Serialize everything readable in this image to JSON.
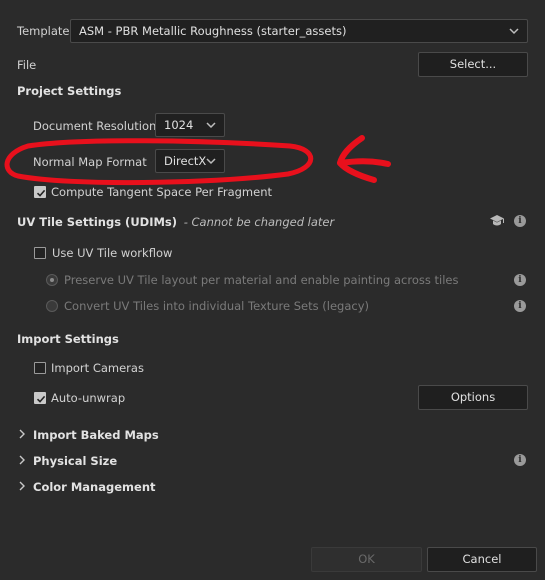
{
  "template": {
    "label": "Template",
    "value": "ASM - PBR Metallic Roughness (starter_assets)"
  },
  "file": {
    "label": "File",
    "button": "Select..."
  },
  "project_settings": {
    "heading": "Project Settings",
    "document_resolution": {
      "label": "Document Resolution",
      "value": "1024"
    },
    "normal_map_format": {
      "label": "Normal Map Format",
      "value": "DirectX"
    },
    "tangent": {
      "label": "Compute Tangent Space Per Fragment",
      "checked": true
    }
  },
  "uv_tile": {
    "heading": "UV Tile Settings (UDIMs)",
    "note": "- Cannot be changed later",
    "use_workflow": {
      "label": "Use UV Tile workflow",
      "checked": false
    },
    "option_preserve": "Preserve UV Tile layout per material and enable painting across tiles",
    "option_convert": "Convert UV Tiles into individual Texture Sets (legacy)"
  },
  "import_settings": {
    "heading": "Import Settings",
    "import_cameras": {
      "label": "Import Cameras",
      "checked": false
    },
    "auto_unwrap": {
      "label": "Auto-unwrap",
      "checked": true
    },
    "options_button": "Options"
  },
  "sections": {
    "baked_maps": "Import Baked Maps",
    "physical_size": "Physical Size",
    "color_management": "Color Management"
  },
  "footer": {
    "ok": "OK",
    "cancel": "Cancel"
  },
  "colors": {
    "annotation": "#e8101c",
    "background": "#2b2b2b"
  },
  "icons": [
    "chevron-down-icon",
    "check-icon",
    "info-icon",
    "graduation-cap-icon",
    "chevron-right-icon",
    "red-arrow-annotation"
  ]
}
